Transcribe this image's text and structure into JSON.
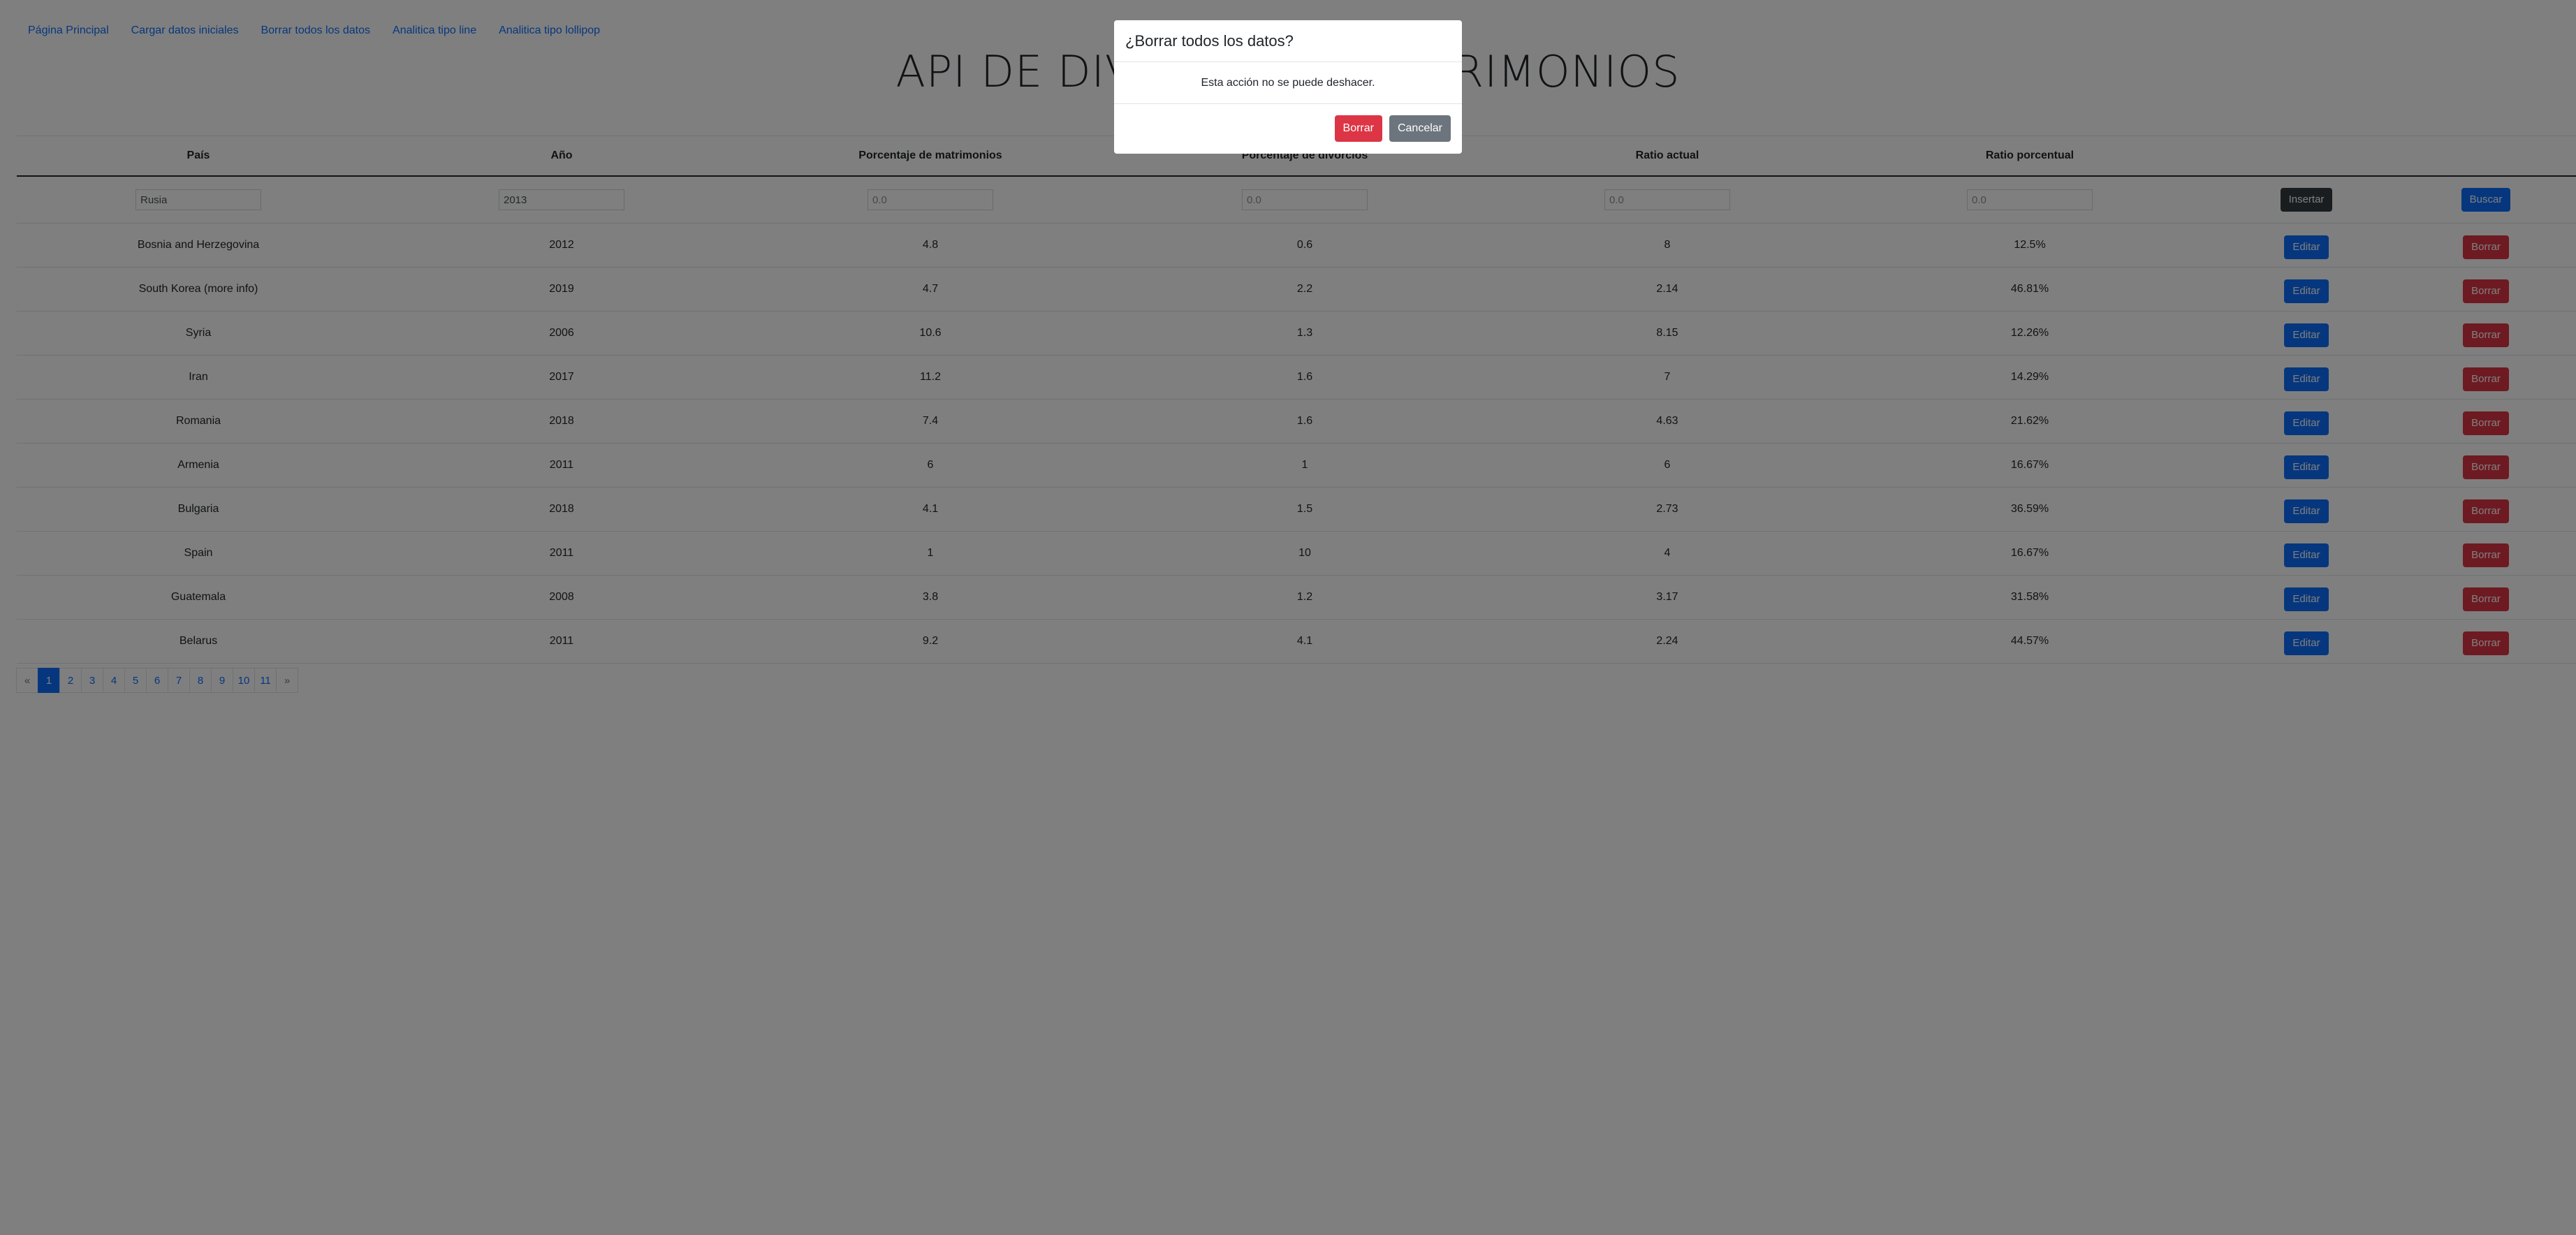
{
  "nav": [
    "Página Principal",
    "Cargar datos iniciales",
    "Borrar todos los datos",
    "Analitica tipo line",
    "Analitica tipo lollipop"
  ],
  "title": "API DE DIVORCIOS Y MATRIMONIOS",
  "table": {
    "headers": [
      "País",
      "Año",
      "Porcentaje de matrimonios",
      "Porcentaje de divorcios",
      "Ratio actual",
      "Ratio porcentual"
    ],
    "inputs": {
      "country": "Rusia",
      "year": "2013",
      "marriage_placeholder": "0.0",
      "divorce_placeholder": "0.0",
      "ratio_actual_placeholder": "0.0",
      "ratio_percent_placeholder": "0.0"
    },
    "insert_label": "Insertar",
    "search_label": "Buscar",
    "edit_label": "Editar",
    "delete_label": "Borrar",
    "rows": [
      [
        "Bosnia and Herzegovina",
        "2012",
        "4.8",
        "0.6",
        "8",
        "12.5%"
      ],
      [
        "South Korea (more info)",
        "2019",
        "4.7",
        "2.2",
        "2.14",
        "46.81%"
      ],
      [
        "Syria",
        "2006",
        "10.6",
        "1.3",
        "8.15",
        "12.26%"
      ],
      [
        "Iran",
        "2017",
        "11.2",
        "1.6",
        "7",
        "14.29%"
      ],
      [
        "Romania",
        "2018",
        "7.4",
        "1.6",
        "4.63",
        "21.62%"
      ],
      [
        "Armenia",
        "2011",
        "6",
        "1",
        "6",
        "16.67%"
      ],
      [
        "Bulgaria",
        "2018",
        "4.1",
        "1.5",
        "2.73",
        "36.59%"
      ],
      [
        "Spain",
        "2011",
        "1",
        "10",
        "4",
        "16.67%"
      ],
      [
        "Guatemala",
        "2008",
        "3.8",
        "1.2",
        "3.17",
        "31.58%"
      ],
      [
        "Belarus",
        "2011",
        "9.2",
        "4.1",
        "2.24",
        "44.57%"
      ]
    ]
  },
  "pagination": {
    "prev": "«",
    "next": "»",
    "pages": [
      "1",
      "2",
      "3",
      "4",
      "5",
      "6",
      "7",
      "8",
      "9",
      "10",
      "11"
    ],
    "active": "1"
  },
  "modal": {
    "title": "¿Borrar todos los datos?",
    "body": "Esta acción no se puede deshacer.",
    "confirm_label": "Borrar",
    "cancel_label": "Cancelar"
  },
  "colors": {
    "primary": "#0d6efd",
    "danger": "#dc3545",
    "secondary": "#6c757d",
    "dark": "#343a40"
  }
}
